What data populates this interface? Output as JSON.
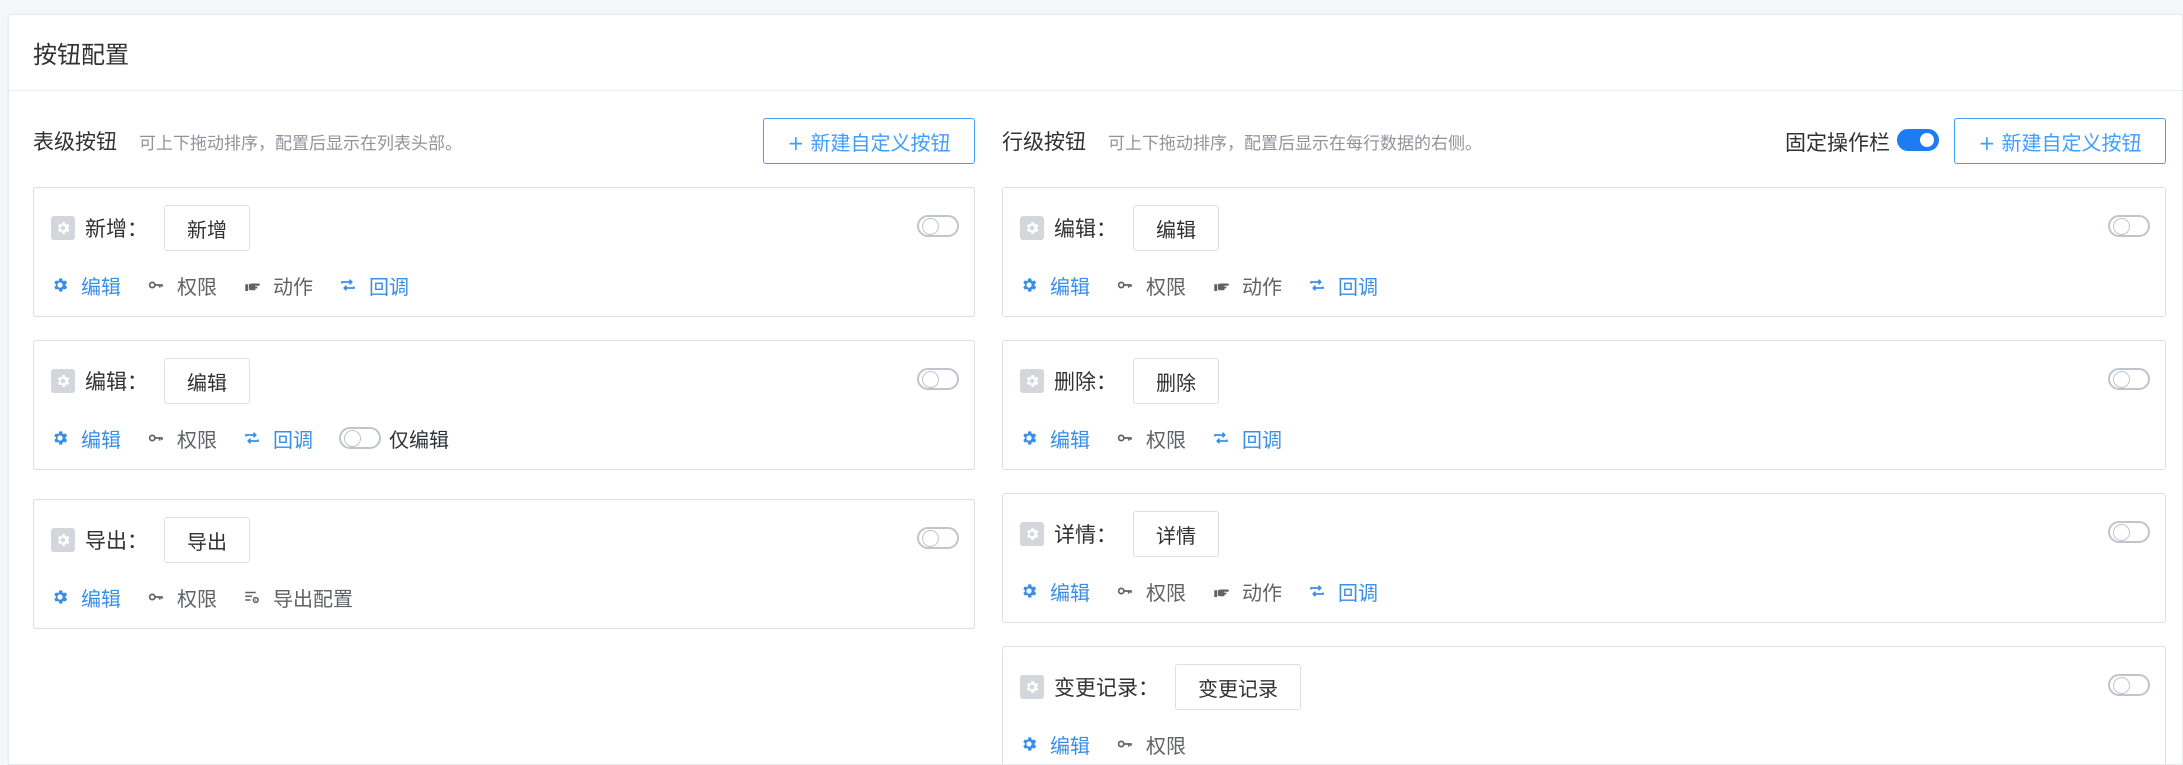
{
  "header": {
    "title": "按钮配置"
  },
  "colors": {
    "accent": "#409eff",
    "link": "#3a8ee6",
    "border": "#dcdfe6",
    "muted": "#909399"
  },
  "table_section": {
    "title": "表级按钮",
    "desc": "可上下拖动排序，配置后显示在列表头部。",
    "new_btn": "+ 新建自定义按钮",
    "cards": [
      {
        "label": "新增：",
        "button": "新增",
        "enabled": false,
        "actions": [
          {
            "icon": "gear-icon",
            "text": "编辑",
            "tone": "blue"
          },
          {
            "icon": "key-icon",
            "text": "权限",
            "tone": "gray"
          },
          {
            "icon": "hand-pointer-icon",
            "text": "动作",
            "tone": "gray"
          },
          {
            "icon": "repeat-icon",
            "text": "回调",
            "tone": "blue"
          }
        ]
      },
      {
        "label": "编辑：",
        "button": "编辑",
        "enabled": false,
        "actions": [
          {
            "icon": "gear-icon",
            "text": "编辑",
            "tone": "blue"
          },
          {
            "icon": "key-icon",
            "text": "权限",
            "tone": "gray"
          },
          {
            "icon": "repeat-icon",
            "text": "回调",
            "tone": "blue"
          }
        ],
        "extra_toggle": {
          "text": "仅编辑",
          "on": false
        }
      },
      {
        "label": "导出：",
        "button": "导出",
        "enabled": false,
        "actions": [
          {
            "icon": "gear-icon",
            "text": "编辑",
            "tone": "blue"
          },
          {
            "icon": "key-icon",
            "text": "权限",
            "tone": "gray"
          },
          {
            "icon": "export-settings-icon",
            "text": "导出配置",
            "tone": "gray"
          }
        ]
      }
    ]
  },
  "row_section": {
    "title": "行级按钮",
    "desc": "可上下拖动排序，配置后显示在每行数据的右侧。",
    "fixed_label": "固定操作栏",
    "fixed_on": true,
    "new_btn": "+ 新建自定义按钮",
    "cards": [
      {
        "label": "编辑：",
        "button": "编辑",
        "enabled": false,
        "actions": [
          {
            "icon": "gear-icon",
            "text": "编辑",
            "tone": "blue"
          },
          {
            "icon": "key-icon",
            "text": "权限",
            "tone": "gray"
          },
          {
            "icon": "hand-pointer-icon",
            "text": "动作",
            "tone": "gray"
          },
          {
            "icon": "repeat-icon",
            "text": "回调",
            "tone": "blue"
          }
        ]
      },
      {
        "label": "删除：",
        "button": "删除",
        "enabled": false,
        "actions": [
          {
            "icon": "gear-icon",
            "text": "编辑",
            "tone": "blue"
          },
          {
            "icon": "key-icon",
            "text": "权限",
            "tone": "gray"
          },
          {
            "icon": "repeat-icon",
            "text": "回调",
            "tone": "blue"
          }
        ]
      },
      {
        "label": "详情：",
        "button": "详情",
        "enabled": false,
        "actions": [
          {
            "icon": "gear-icon",
            "text": "编辑",
            "tone": "blue"
          },
          {
            "icon": "key-icon",
            "text": "权限",
            "tone": "gray"
          },
          {
            "icon": "hand-pointer-icon",
            "text": "动作",
            "tone": "gray"
          },
          {
            "icon": "repeat-icon",
            "text": "回调",
            "tone": "blue"
          }
        ]
      },
      {
        "label": "变更记录：",
        "button": "变更记录",
        "enabled": false,
        "actions": [
          {
            "icon": "gear-icon",
            "text": "编辑",
            "tone": "blue"
          },
          {
            "icon": "key-icon",
            "text": "权限",
            "tone": "gray"
          }
        ]
      }
    ]
  }
}
